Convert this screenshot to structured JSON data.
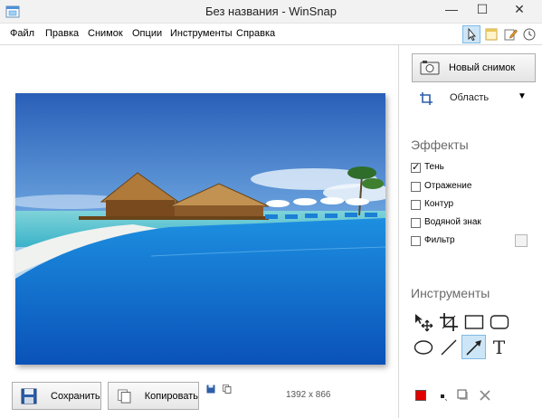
{
  "window": {
    "title": "Без названия - WinSnap",
    "minimize_glyph": "—",
    "maximize_glyph": "☐",
    "close_glyph": "✕"
  },
  "menu": {
    "items": [
      "Файл",
      "Правка",
      "Снимок",
      "Опции",
      "Инструменты",
      "Справка"
    ]
  },
  "mode_buttons": [
    "pointer-icon",
    "window-capture-icon",
    "edit-icon",
    "clock-icon"
  ],
  "canvas": {
    "image_description_icon": "beach-photo",
    "scroll_arrow": "▼"
  },
  "bottombar": {
    "save_label": "Сохранить",
    "copy_label": "Копировать",
    "dimensions": "1392 x 866"
  },
  "panel": {
    "new_snapshot_label": "Новый снимок",
    "capture_mode": "Область",
    "effects_title": "Эффекты",
    "effects": [
      {
        "label": "Тень",
        "checked": true
      },
      {
        "label": "Отражение",
        "checked": false
      },
      {
        "label": "Контур",
        "checked": false
      },
      {
        "label": "Водяной знак",
        "checked": false
      },
      {
        "label": "Фильтр",
        "checked": false
      }
    ],
    "tools_title": "Инструменты",
    "text_tool_glyph": "T",
    "active_tool": "arrow",
    "color_accent": "#e00000"
  },
  "colors": {
    "selection": "#cde6f7",
    "selection_border": "#80b9e3"
  }
}
